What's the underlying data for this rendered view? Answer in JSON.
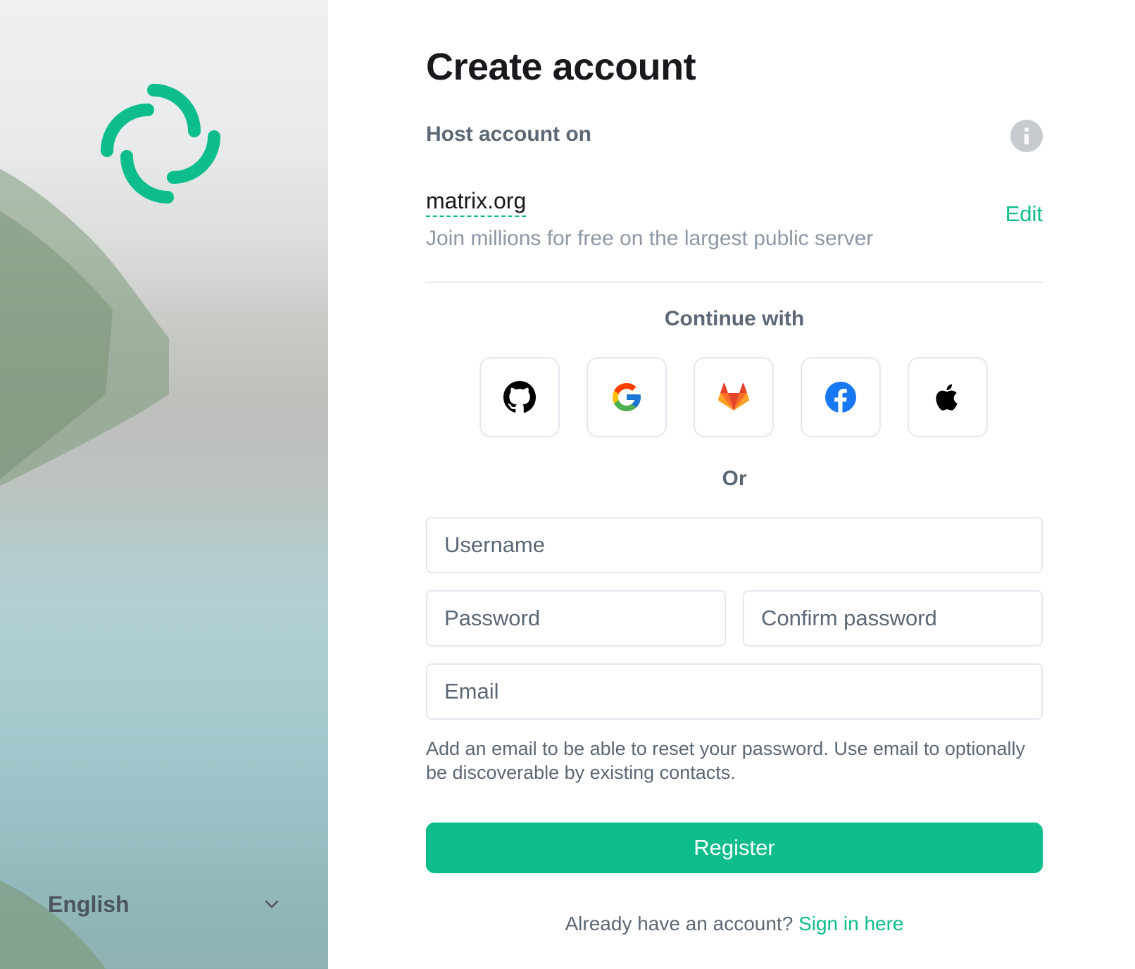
{
  "brand": {
    "accent": "#0dbd8b",
    "logo_icon": "element-logo-icon"
  },
  "language": {
    "selected": "English"
  },
  "form": {
    "title": "Create account",
    "host_label": "Host account on",
    "server_name": "matrix.org",
    "server_description": "Join millions for free on the largest public server",
    "edit_label": "Edit",
    "continue_with": "Continue with",
    "sso_providers": [
      {
        "icon": "github-icon"
      },
      {
        "icon": "google-icon"
      },
      {
        "icon": "gitlab-icon"
      },
      {
        "icon": "facebook-icon"
      },
      {
        "icon": "apple-icon"
      }
    ],
    "or_label": "Or",
    "fields": {
      "username": {
        "placeholder": "Username",
        "value": ""
      },
      "password": {
        "placeholder": "Password",
        "value": ""
      },
      "confirm_password": {
        "placeholder": "Confirm password",
        "value": ""
      },
      "email": {
        "placeholder": "Email",
        "value": ""
      }
    },
    "email_help": "Add an email to be able to reset your password. Use email to optionally be discoverable by existing contacts.",
    "register_label": "Register",
    "signin_prompt": "Already have an account?",
    "signin_link": "Sign in here"
  }
}
